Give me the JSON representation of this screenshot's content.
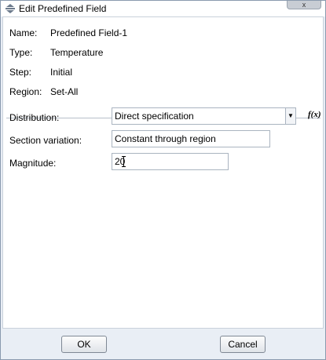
{
  "window": {
    "title": "Edit Predefined Field",
    "close_glyph": "x"
  },
  "info": [
    {
      "label": "Name:",
      "value": "Predefined Field-1"
    },
    {
      "label": "Type:",
      "value": "Temperature"
    },
    {
      "label": "Step:",
      "value": "Initial"
    },
    {
      "label": "Region:",
      "value": "Set-All"
    }
  ],
  "form": {
    "distribution_label": "Distribution:",
    "distribution_value": "Direct specification",
    "fx_label": "f(x)",
    "section_variation_label": "Section variation:",
    "section_variation_value": "Constant through region",
    "magnitude_label": "Magnitude:",
    "magnitude_value": "20"
  },
  "buttons": {
    "ok": "OK",
    "cancel": "Cancel"
  },
  "icons": {
    "app": "abaqus-field-icon",
    "dropdown": "chevron-down-icon"
  }
}
